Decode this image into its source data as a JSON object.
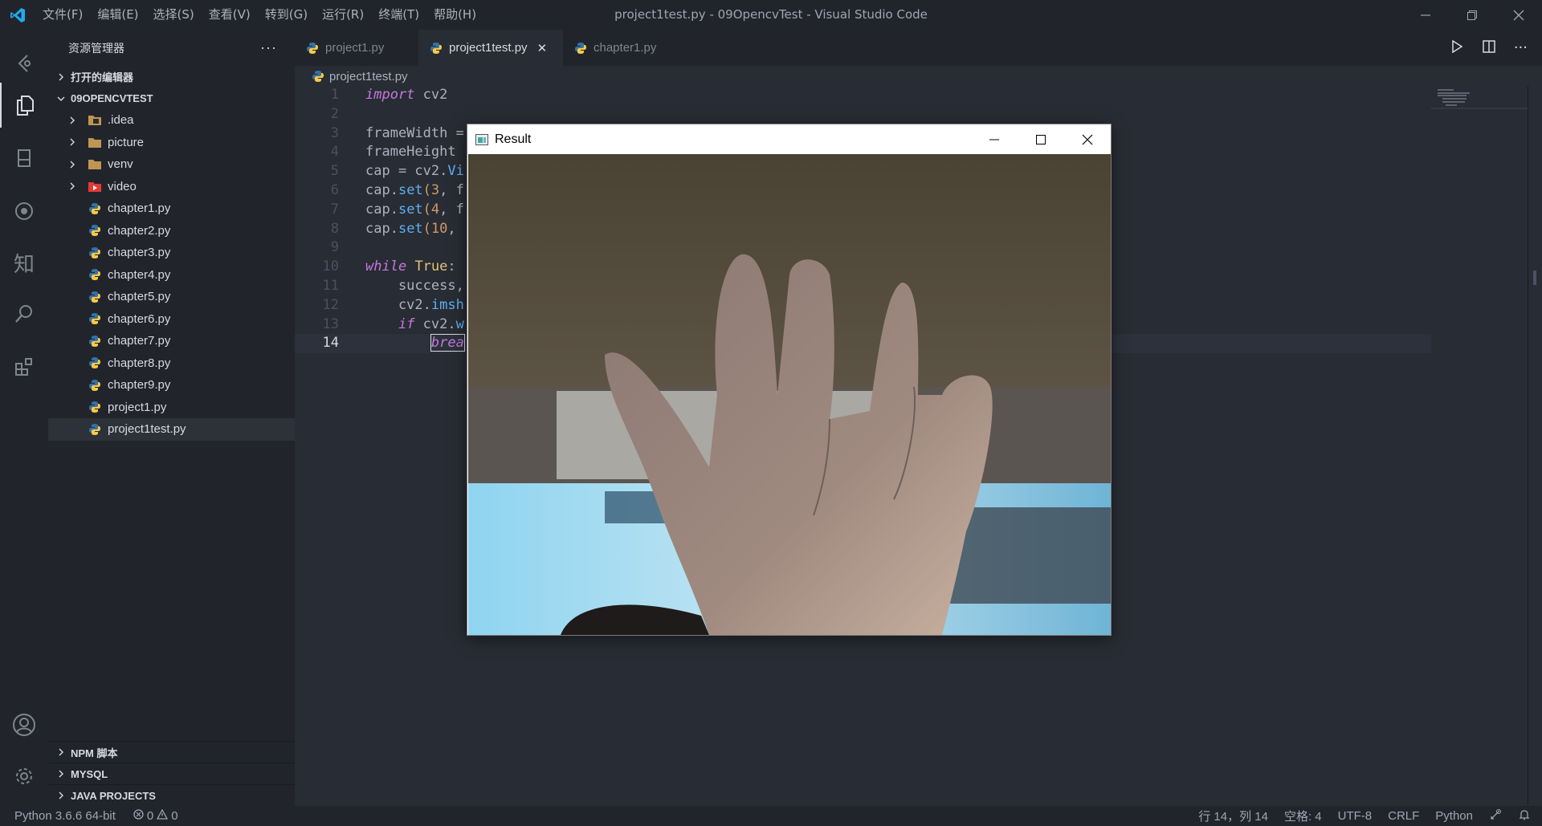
{
  "window": {
    "title": "project1test.py - 09OpencvTest - Visual Studio Code"
  },
  "menu": [
    "文件(F)",
    "编辑(E)",
    "选择(S)",
    "查看(V)",
    "转到(G)",
    "运行(R)",
    "终端(T)",
    "帮助(H)"
  ],
  "sidebar": {
    "title": "资源管理器",
    "open_editors": "打开的编辑器",
    "project": "09OPENCVTEST",
    "folders": [
      ".idea",
      "picture",
      "venv",
      "video"
    ],
    "files": [
      "chapter1.py",
      "chapter2.py",
      "chapter3.py",
      "chapter4.py",
      "chapter5.py",
      "chapter6.py",
      "chapter7.py",
      "chapter8.py",
      "chapter9.py",
      "project1.py",
      "project1test.py"
    ],
    "bottom_sections": [
      "NPM 脚本",
      "MYSQL",
      "JAVA PROJECTS"
    ]
  },
  "tabs": [
    {
      "label": "project1.py"
    },
    {
      "label": "project1test.py",
      "close": "✕"
    },
    {
      "label": "chapter1.py"
    }
  ],
  "breadcrumb": "project1test.py",
  "editor": {
    "line_numbers": [
      "1",
      "2",
      "3",
      "4",
      "5",
      "6",
      "7",
      "8",
      "9",
      "10",
      "11",
      "12",
      "13",
      "14"
    ],
    "visible_code_fragments": {
      "l1_kw": "import",
      "l1_rest": " cv2",
      "l3": "frameWidth =",
      "l4": "frameHeight",
      "l5_a": "cap = cv2.",
      "l5_b": "Vi",
      "l6_a": "cap.",
      "l6_b": "set",
      "l6_c": "(",
      "l6_d": "3",
      "l6_e": ", f",
      "l7_a": "cap.",
      "l7_b": "set",
      "l7_c": "(",
      "l7_d": "4",
      "l7_e": ", f",
      "l8_a": "cap.",
      "l8_b": "set",
      "l8_c": "(",
      "l8_d": "10",
      "l8_e": ",",
      "l10_kw": "while",
      "l10_cls": "True",
      "l10_rest": ":",
      "l11": "    success,",
      "l12_a": "    cv2.",
      "l12_b": "imsh",
      "l13_kw": "if",
      "l13_a": " cv2.",
      "l13_b": "w",
      "l14_kw": "brea"
    }
  },
  "result_window": {
    "title": "Result"
  },
  "statusbar": {
    "interpreter": "Python 3.6.6 64-bit",
    "errors": "0",
    "warnings": "0",
    "position": "行 14，列 14",
    "spaces": "空格: 4",
    "encoding": "UTF-8",
    "eol": "CRLF",
    "language": "Python"
  },
  "colors": {
    "bg": "#282c34",
    "sidebar": "#21252b",
    "keyword": "#c678dd",
    "function": "#61afef",
    "number": "#d19a66",
    "class": "#e5c07b",
    "vscode_blue": "#23a9f2"
  },
  "icons": [
    "vscode-logo-icon",
    "timeline-icon",
    "explorer-icon",
    "notebook-icon",
    "run-debug-icon",
    "zhihu-icon",
    "search-icon",
    "extensions-icon",
    "account-icon",
    "settings-icon",
    "python-file-icon",
    "folder-icon",
    "run-icon",
    "split-editor-icon",
    "more-icon",
    "error-icon",
    "warning-icon",
    "feedback-icon",
    "bell-icon"
  ]
}
